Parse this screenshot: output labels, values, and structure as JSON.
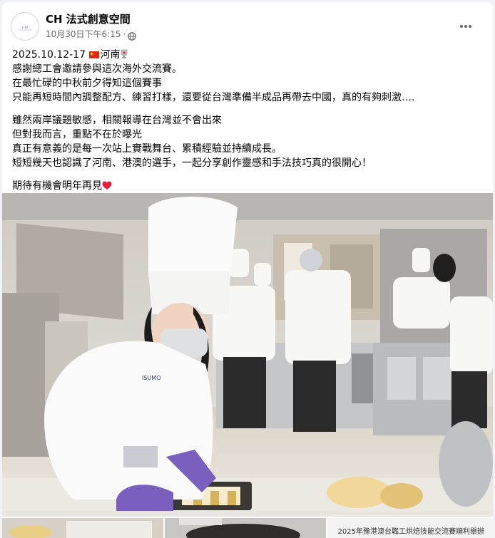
{
  "post": {
    "author": "CH 法式創意空間",
    "timestamp": "10月30日下午6:15",
    "separator": "·",
    "audience_icon": "globe-icon",
    "menu_icon": "more-options-icon",
    "lines": {
      "l1_date": "2025.10.12-17 ",
      "l1_place": "河南",
      "l2": "感謝總工會邀請參與這次海外交流賽。",
      "l3": "在最忙碌的中秋前夕得知這個賽事",
      "l4": "只能再短時間內調整配方、練習打樣，還要從台灣準備半成品再帶去中國，真的有夠刺激….",
      "l5": "雖然兩岸議題敏感，相關報導在台灣並不會出來",
      "l6": "但對我而言，重點不在於曝光",
      "l7": "真正有意義的是每一次站上實戰舞台、累積經驗並持續成長。",
      "l8": "短短幾天也認識了河南、港澳的選手，一起分享創作靈感和手法技巧真的很開心！",
      "l9": "期待有機會明年再見"
    },
    "emoji": {
      "flag": "china-flag-icon",
      "trophy": "trophy-icon",
      "heart": "red-heart-icon"
    },
    "photo_caption": "2025年豫港澳台職工烘焙技能交流賽順利舉辦"
  },
  "colors": {
    "secondary_text": "#65676b",
    "heart": "#e41e3f",
    "flag_red": "#de2910"
  }
}
